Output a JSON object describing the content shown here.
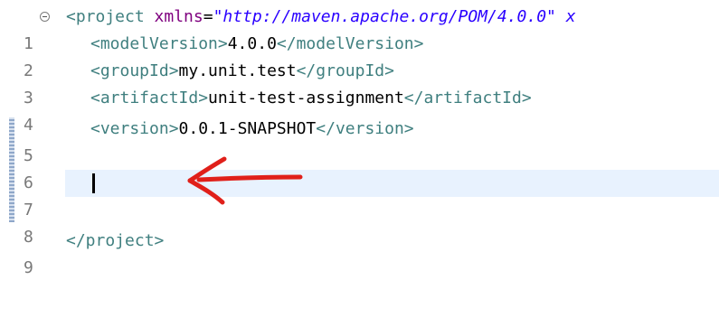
{
  "editor": {
    "lines": [
      {
        "num": "1",
        "tokens": {
          "open": "<project ",
          "attr": "xmlns",
          "eq": "=",
          "val": "\"http://maven.apache.org/POM/4.0.0\" x"
        }
      },
      {
        "num": "2",
        "tokens": {
          "open": "<modelVersion>",
          "text": "4.0.0",
          "close": "</modelVersion>"
        }
      },
      {
        "num": "3",
        "tokens": {
          "open": "<groupId>",
          "text": "my.unit.test",
          "close": "</groupId>"
        }
      },
      {
        "num": "4",
        "tokens": {
          "open": "<artifactId>",
          "text": "unit-test-assignment",
          "close": "</artifactId>"
        }
      },
      {
        "num": "5",
        "tokens": {
          "open": "<version>",
          "text": "0.0.1-SNAPSHOT",
          "close": "</version>"
        }
      },
      {
        "num": "6"
      },
      {
        "num": "7"
      },
      {
        "num": "8"
      },
      {
        "num": "9",
        "tokens": {
          "close": "</project>"
        }
      }
    ]
  },
  "colors": {
    "tag": "#3f7f7f",
    "attribute": "#7f007f",
    "attribute_value": "#2a00ff",
    "current_line": "#e8f2fe",
    "annotation_arrow": "#e0201a"
  }
}
